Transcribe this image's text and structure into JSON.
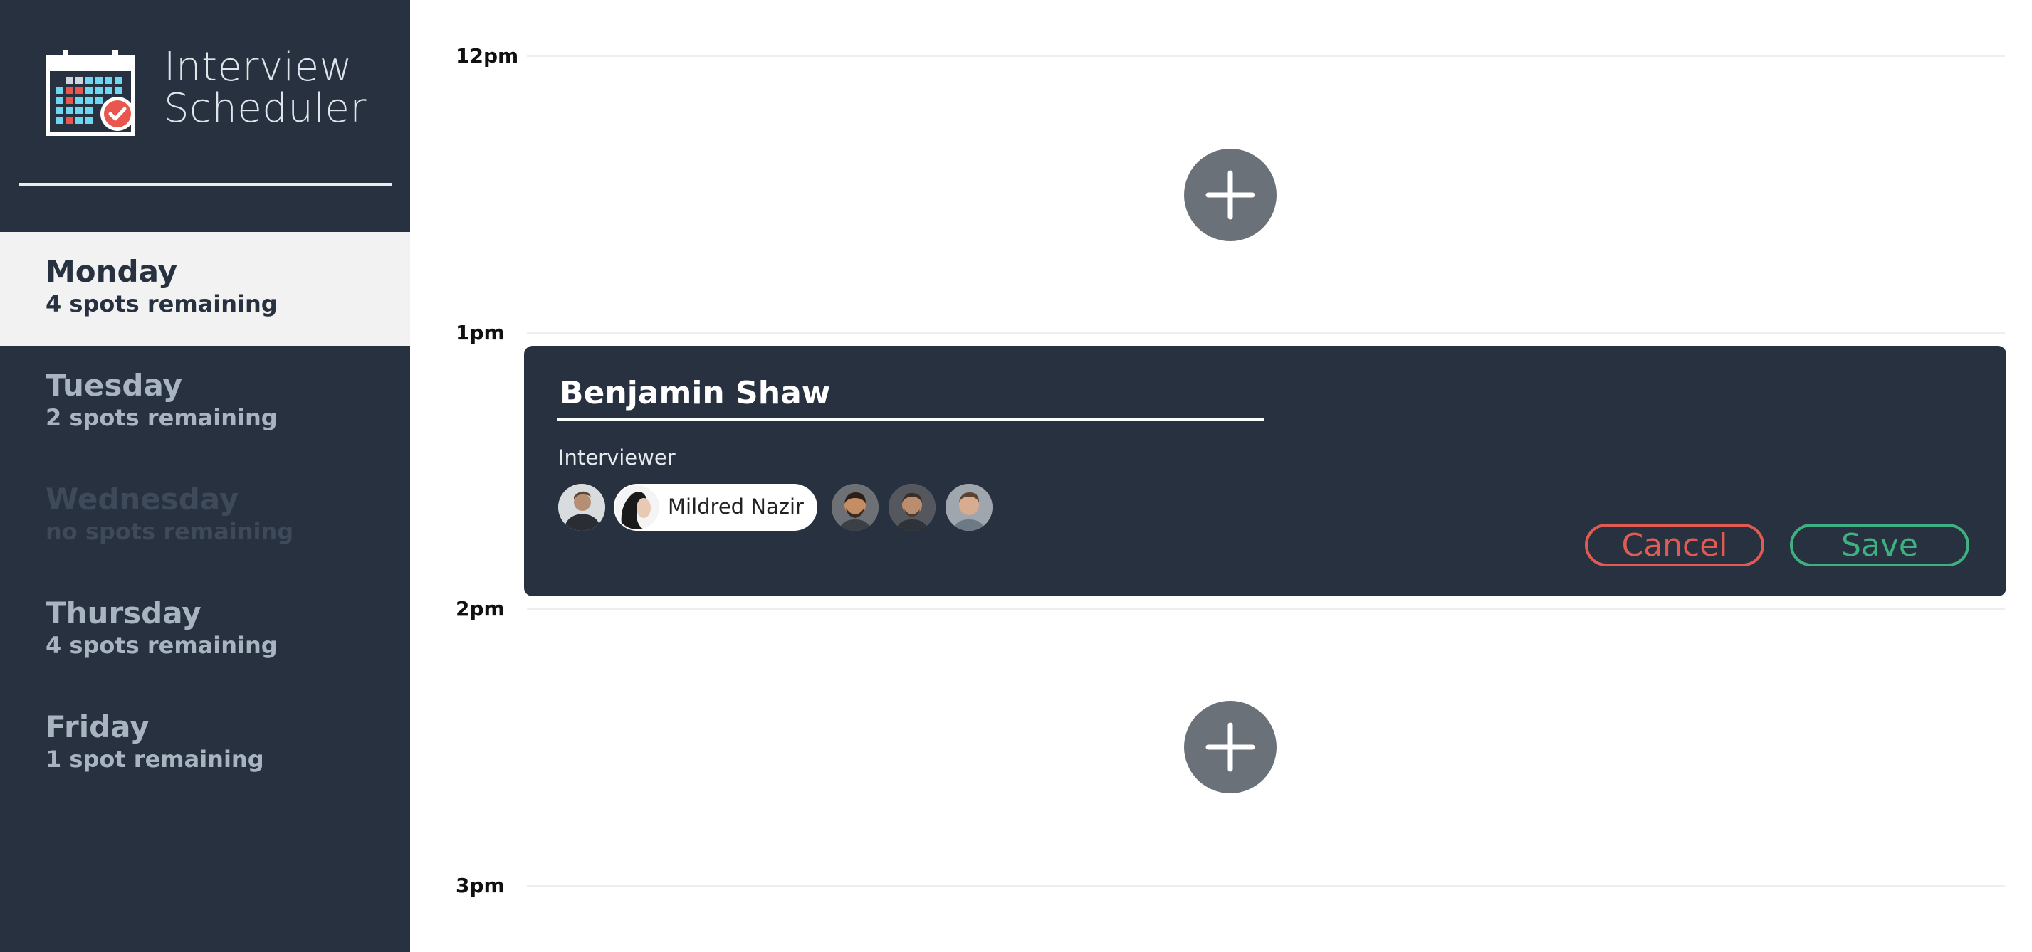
{
  "app": {
    "title_line1": "Interview",
    "title_line2": "Scheduler"
  },
  "sidebar": {
    "days": [
      {
        "name": "Monday",
        "spots": "4 spots remaining",
        "state": "selected"
      },
      {
        "name": "Tuesday",
        "spots": "2 spots remaining",
        "state": "normal"
      },
      {
        "name": "Wednesday",
        "spots": "no spots remaining",
        "state": "full"
      },
      {
        "name": "Thursday",
        "spots": "4 spots remaining",
        "state": "normal"
      },
      {
        "name": "Friday",
        "spots": "1 spot remaining",
        "state": "normal"
      }
    ]
  },
  "schedule": {
    "times": [
      "12pm",
      "1pm",
      "2pm",
      "3pm"
    ]
  },
  "form": {
    "student_name": "Benjamin Shaw",
    "interviewer_label": "Interviewer",
    "selected_interviewer": "Mildred Nazir",
    "cancel_label": "Cancel",
    "save_label": "Save"
  },
  "icons": {
    "logo": "calendar-check-icon",
    "add": "plus-icon"
  },
  "colors": {
    "sidebar_bg": "#27313f",
    "cancel": "#e25b52",
    "save": "#3fb07f",
    "add_button": "#6b7179"
  }
}
